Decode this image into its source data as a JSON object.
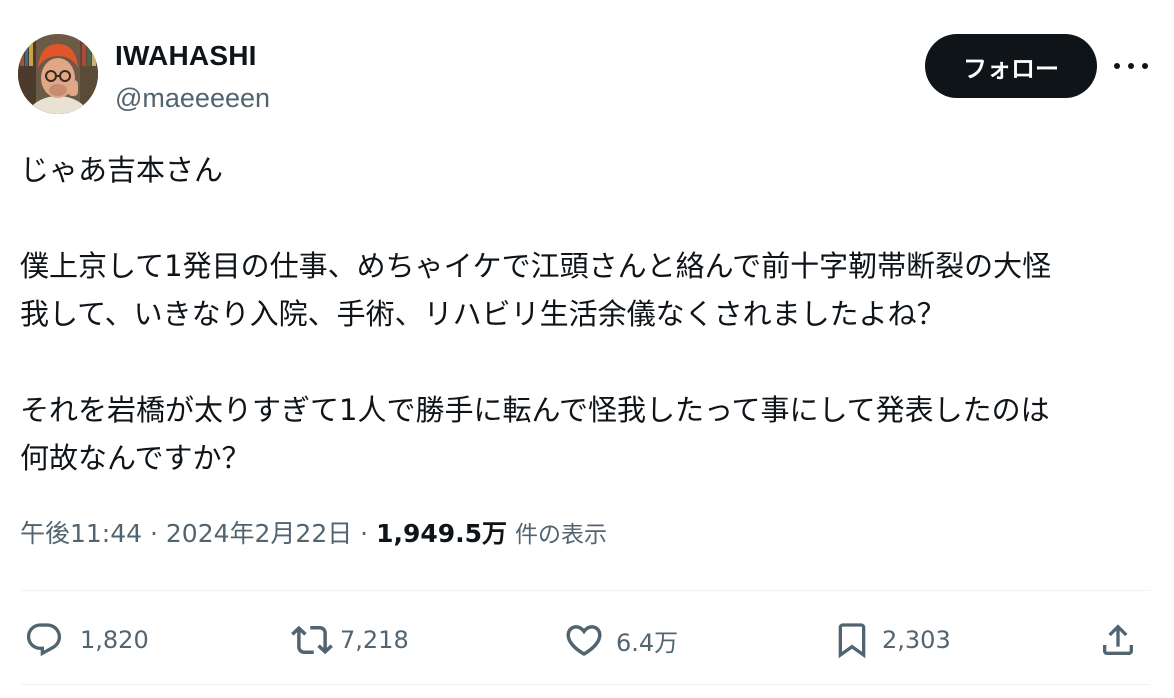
{
  "user": {
    "display_name": "IWAHASHI",
    "handle": "@maeeeeen",
    "avatar_icon": "profile-photo"
  },
  "follow_label": "フォロー",
  "more_icon": "more-horizontal-icon",
  "tweet": {
    "lines": [
      "じゃあ吉本さん",
      "僕上京して1発目の仕事、めちゃイケで江頭さんと絡んで前十字靭帯断裂の大怪",
      "我して、いきなり入院、手術、リハビリ生活余儀なくされましたよね？",
      "それを岩橋が太りすぎて1人で勝手に転んで怪我したって事にして発表したのは",
      "何故なんですか？"
    ]
  },
  "meta": {
    "time": "午後11:44",
    "separator": " · ",
    "date": "2024年2月22日",
    "views_count": "1,949.5万",
    "views_label": "件の表示"
  },
  "actions": {
    "reply": {
      "icon": "reply-icon",
      "count": "1,820"
    },
    "retweet": {
      "icon": "retweet-icon",
      "count": "7,218"
    },
    "like": {
      "icon": "heart-icon",
      "count": "6.4万"
    },
    "bookmark": {
      "icon": "bookmark-icon",
      "count": "2,303"
    },
    "share": {
      "icon": "share-icon"
    }
  },
  "colors": {
    "text_primary": "#0f1419",
    "text_secondary": "#536471",
    "button_bg": "#0f1419",
    "divider": "#eff3f4"
  }
}
